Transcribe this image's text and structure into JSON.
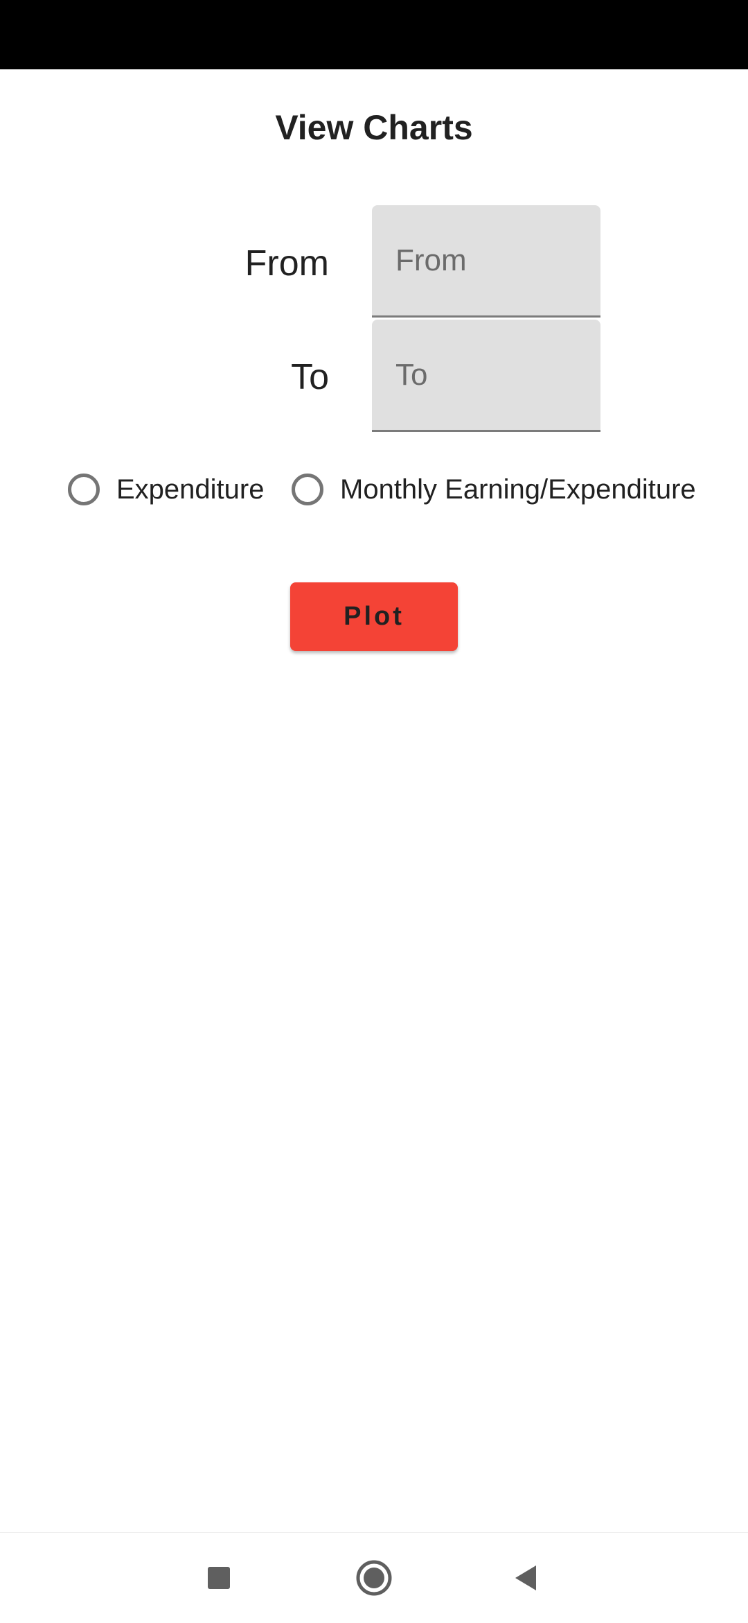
{
  "screen": {
    "title": "View Charts"
  },
  "form": {
    "from_label": "From",
    "from_placeholder": "From",
    "from_value": "",
    "to_label": "To",
    "to_placeholder": "To",
    "to_value": ""
  },
  "chart_type": {
    "options": [
      {
        "label": "Expenditure",
        "selected": false
      },
      {
        "label": "Monthly Earning/Expenditure",
        "selected": false
      }
    ]
  },
  "actions": {
    "plot_label": "Plot"
  },
  "navigation": {
    "icons": [
      "recents-icon",
      "home-icon",
      "back-icon"
    ]
  },
  "colors": {
    "accent": "#f44336",
    "field_background": "#e0e0e0",
    "status_bar": "#000000",
    "radio_outline": "#757575",
    "nav_icon": "#5f5f5f"
  }
}
